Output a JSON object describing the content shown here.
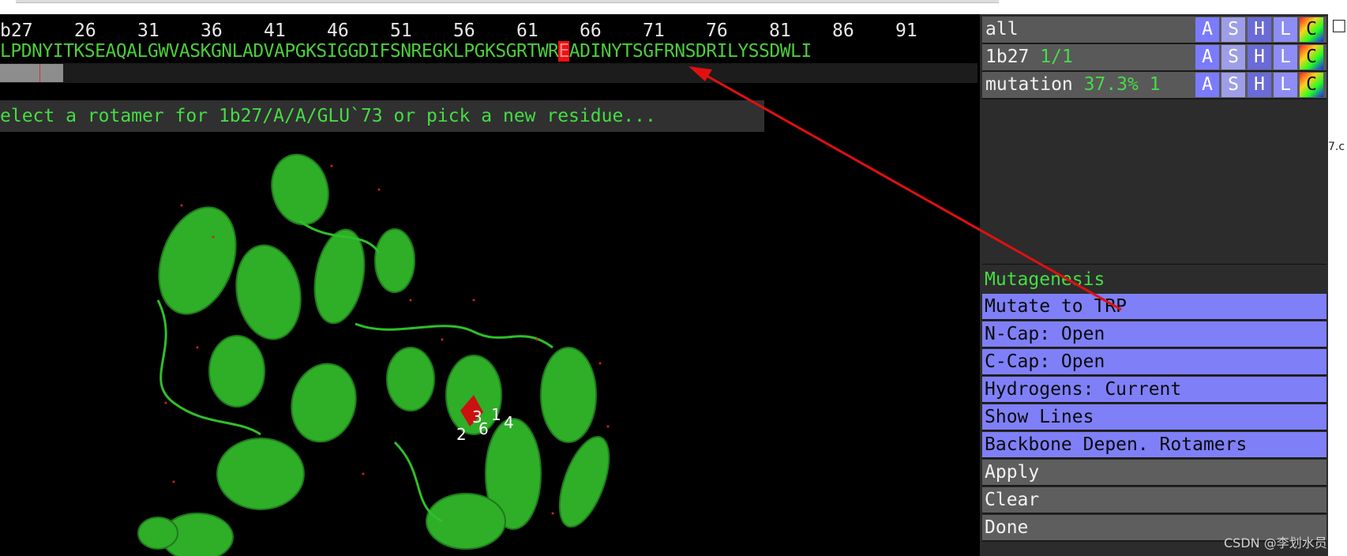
{
  "sequence": {
    "object_label": "b27",
    "numbers": [
      "26",
      "31",
      "36",
      "41",
      "46",
      "51",
      "56",
      "61",
      "66",
      "71",
      "76",
      "81",
      "86",
      "91"
    ],
    "residues_before": "LPDNYITKSEAQALGWVASKGNLADVAPGKSIGGDIFSNREGKLPGKSGRTWR",
    "selected_residue": "E",
    "residues_after": "ADINYTSGFRNSDRILYSSDWLI"
  },
  "prompt_text": "elect a rotamer for 1b27/A/A/GLU`73 or pick a new residue...",
  "rotamer_labels": [
    "3",
    "1",
    "2",
    "6",
    "4"
  ],
  "objects": [
    {
      "name": "all",
      "extra": ""
    },
    {
      "name": "1b27",
      "extra": "1/1"
    },
    {
      "name": "mutation",
      "extra": "37.3% 1"
    }
  ],
  "object_buttons": [
    "A",
    "S",
    "H",
    "L",
    "C"
  ],
  "wizard": {
    "title": "Mutagenesis",
    "items": [
      "Mutate to TRP",
      "N-Cap: Open",
      "C-Cap: Open",
      "Hydrogens: Current",
      "Show Lines",
      "Backbone Depen. Rotamers"
    ],
    "actions": [
      "Apply",
      "Clear",
      "Done"
    ]
  },
  "right_fragment": "7.c",
  "watermark": "CSDN @李划水员",
  "colors": {
    "sequence": "#4ccd3a",
    "highlight": "#e11111",
    "panel_blue": "#7f7ff8",
    "annotation_arrow": "#e01010"
  }
}
